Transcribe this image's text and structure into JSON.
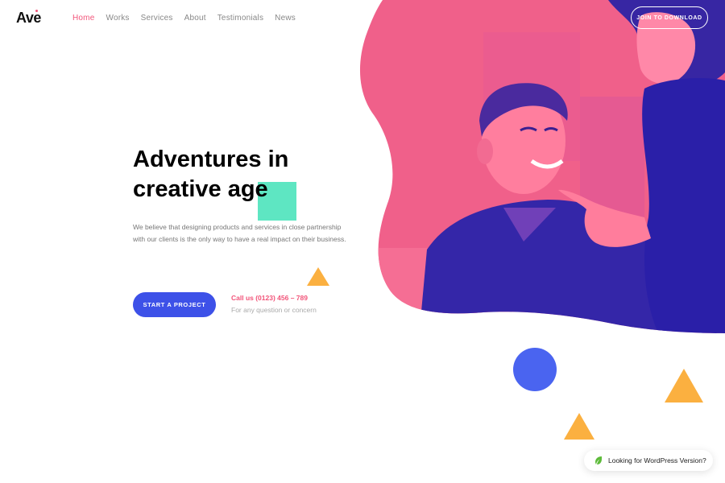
{
  "header": {
    "logo": "Ave",
    "nav": [
      "Home",
      "Works",
      "Services",
      "About",
      "Testimonials",
      "News"
    ],
    "active_nav": "Home",
    "join_label": "JOIN TO DOWNLOAD"
  },
  "hero": {
    "headline_line1": "Adventures in",
    "headline_line2": "creative age",
    "description": "We believe that designing products and services in close partnership with our clients is the only way to have a real impact on their business.",
    "cta_label": "START A PROJECT",
    "call_label": "Call us (0123) 456 – 789",
    "call_sub": "For any question or concern"
  },
  "wordpress_pill": {
    "label": "Looking for WordPress Version?",
    "icon": "leaf-icon"
  },
  "colors": {
    "accent_pink": "#f2557a",
    "button_blue": "#3d51e8",
    "shape_green": "#5ee6c2",
    "shape_orange": "#fbb040",
    "circle_blue": "#4a64f0",
    "photo_duotone_pink": "#f0608a",
    "photo_duotone_blue": "#2a1fa8"
  }
}
